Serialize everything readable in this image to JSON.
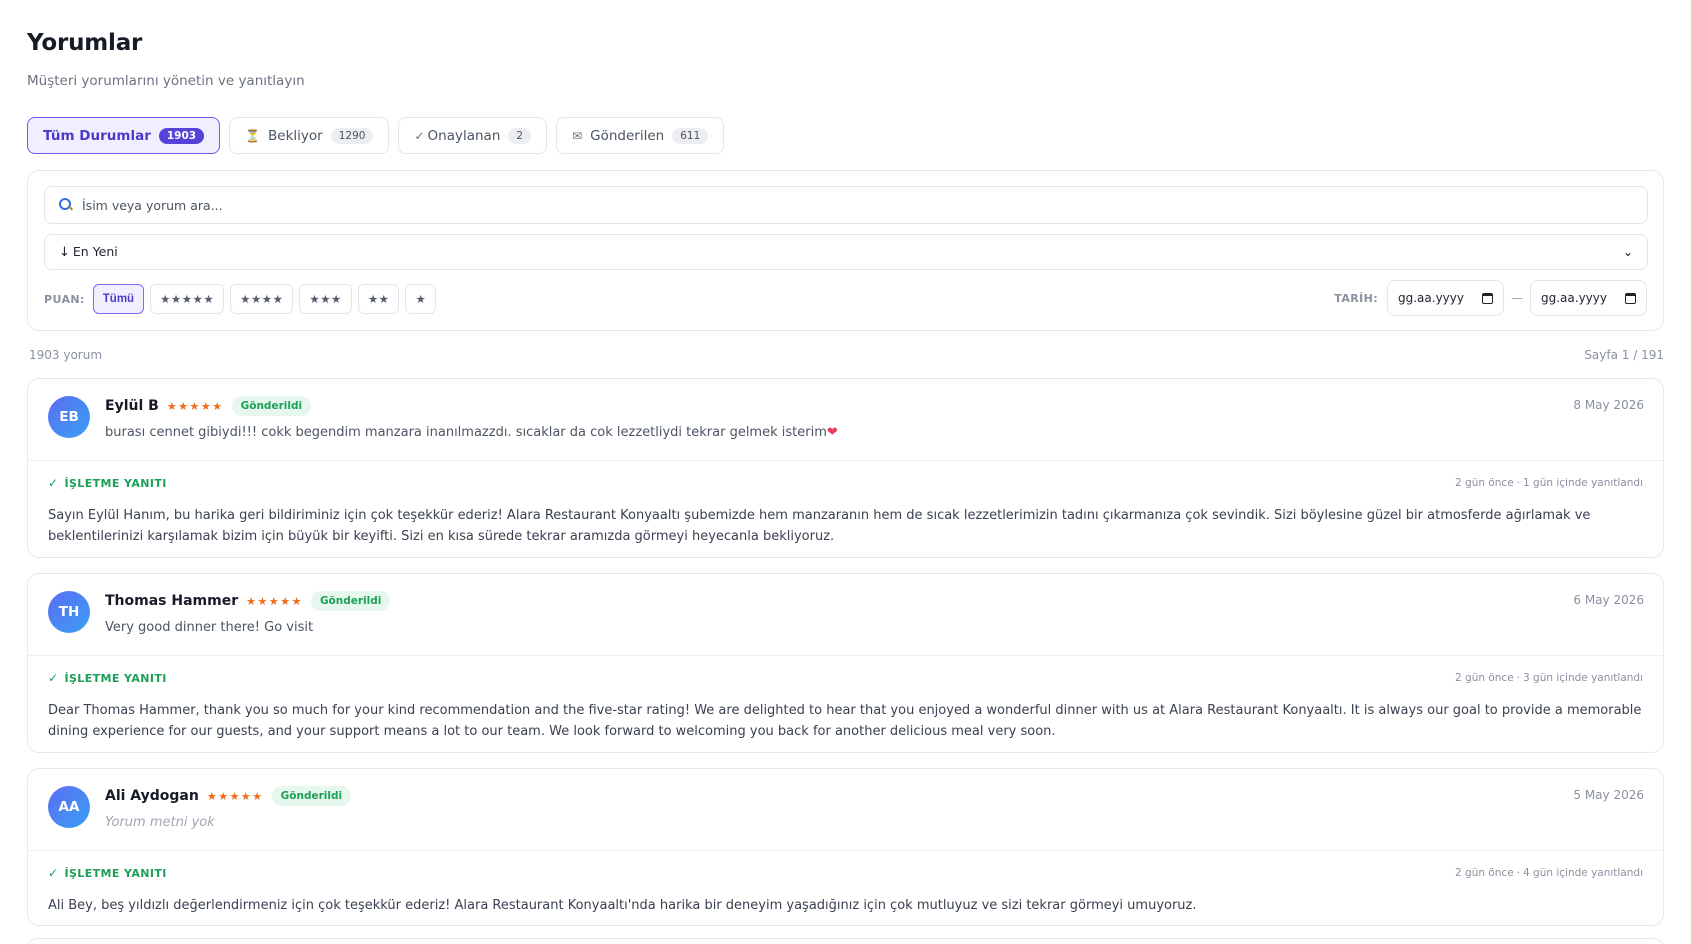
{
  "header": {
    "title": "Yorumlar",
    "subtitle": "Müşteri yorumlarını yönetin ve yanıtlayın"
  },
  "tabs": [
    {
      "label": "Tüm Durumlar",
      "count": "1903",
      "icon": ""
    },
    {
      "label": "Bekliyor",
      "count": "1290",
      "icon": "⏳"
    },
    {
      "label": "Onaylanan",
      "count": "2",
      "icon": "✓"
    },
    {
      "label": "Gönderilen",
      "count": "611",
      "icon": "✉"
    }
  ],
  "filters": {
    "search_placeholder": "İsim veya yorum ara...",
    "sort_arrow": "↓",
    "sort_value": "En Yeni",
    "rating_label": "PUAN:",
    "rating_options": [
      "Tümü",
      "★★★★★",
      "★★★★",
      "★★★",
      "★★",
      "★"
    ],
    "date_label": "TARİH:",
    "date_from_placeholder": "gg.aa.yyyy",
    "date_to_placeholder": "gg.aa.yyyy",
    "date_separator": "—"
  },
  "summary": {
    "total": "1903 yorum",
    "page": "Sayfa 1 / 191"
  },
  "reviews": [
    {
      "initials": "EB",
      "name": "Eylül B",
      "stars": "★★★★★",
      "status": "Gönderildi",
      "date": "8 May 2026",
      "text": "burası cennet gibiydi!!! cokk begendim manzara inanılmazzdı. sıcaklar da cok lezzetliydi tekrar gelmek isterim",
      "emoji": "❤",
      "reply_label": "İŞLETME YANITI",
      "reply_ago": "2 gün önce",
      "reply_time": "1 gün içinde yanıtlandı",
      "reply_text": "Sayın Eylül Hanım, bu harika geri bildiriminiz için çok teşekkür ederiz! Alara Restaurant Konyaaltı şubemizde hem manzaranın hem de sıcak lezzetlerimizin tadını çıkarmanıza çok sevindik. Sizi böylesine güzel bir atmosferde ağırlamak ve beklentilerinizi karşılamak bizim için büyük bir keyifti. Sizi en kısa sürede tekrar aramızda görmeyi heyecanla bekliyoruz."
    },
    {
      "initials": "TH",
      "name": "Thomas Hammer",
      "stars": "★★★★★",
      "status": "Gönderildi",
      "date": "6 May 2026",
      "text": "Very good dinner there! Go visit",
      "reply_label": "İŞLETME YANITI",
      "reply_ago": "2 gün önce",
      "reply_time": "3 gün içinde yanıtlandı",
      "reply_text": "Dear Thomas Hammer, thank you so much for your kind recommendation and the five-star rating! We are delighted to hear that you enjoyed a wonderful dinner with us at Alara Restaurant Konyaaltı. It is always our goal to provide a memorable dining experience for our guests, and your support means a lot to our team. We look forward to welcoming you back for another delicious meal very soon."
    },
    {
      "initials": "AA",
      "name": "Ali Aydogan",
      "stars": "★★★★★",
      "status": "Gönderildi",
      "date": "5 May 2026",
      "text": "Yorum metni yok",
      "reply_label": "İŞLETME YANITI",
      "reply_ago": "2 gün önce",
      "reply_time": "4 gün içinde yanıtlandı",
      "reply_text": "Ali Bey, beş yıldızlı değerlendirmeniz için çok teşekkür ederiz! Alara Restaurant Konyaaltı'nda harika bir deneyim yaşadığınız için çok mutluyuz ve sizi tekrar görmeyi umuyoruz."
    }
  ],
  "colors": {
    "accent": "#5544d8",
    "star": "#f06a17",
    "success": "#1c9f57"
  }
}
